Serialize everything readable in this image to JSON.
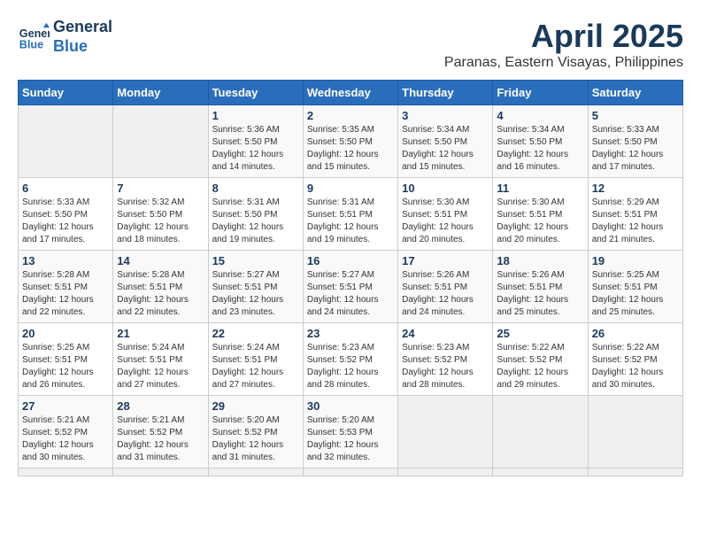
{
  "header": {
    "logo_line1": "General",
    "logo_line2": "Blue",
    "month": "April 2025",
    "location": "Paranas, Eastern Visayas, Philippines"
  },
  "weekdays": [
    "Sunday",
    "Monday",
    "Tuesday",
    "Wednesday",
    "Thursday",
    "Friday",
    "Saturday"
  ],
  "days": [
    {
      "day": "",
      "info": ""
    },
    {
      "day": "",
      "info": ""
    },
    {
      "day": "1",
      "sunrise": "5:36 AM",
      "sunset": "5:50 PM",
      "daylight": "12 hours and 14 minutes."
    },
    {
      "day": "2",
      "sunrise": "5:35 AM",
      "sunset": "5:50 PM",
      "daylight": "12 hours and 15 minutes."
    },
    {
      "day": "3",
      "sunrise": "5:34 AM",
      "sunset": "5:50 PM",
      "daylight": "12 hours and 15 minutes."
    },
    {
      "day": "4",
      "sunrise": "5:34 AM",
      "sunset": "5:50 PM",
      "daylight": "12 hours and 16 minutes."
    },
    {
      "day": "5",
      "sunrise": "5:33 AM",
      "sunset": "5:50 PM",
      "daylight": "12 hours and 17 minutes."
    },
    {
      "day": "6",
      "sunrise": "5:33 AM",
      "sunset": "5:50 PM",
      "daylight": "12 hours and 17 minutes."
    },
    {
      "day": "7",
      "sunrise": "5:32 AM",
      "sunset": "5:50 PM",
      "daylight": "12 hours and 18 minutes."
    },
    {
      "day": "8",
      "sunrise": "5:31 AM",
      "sunset": "5:50 PM",
      "daylight": "12 hours and 19 minutes."
    },
    {
      "day": "9",
      "sunrise": "5:31 AM",
      "sunset": "5:51 PM",
      "daylight": "12 hours and 19 minutes."
    },
    {
      "day": "10",
      "sunrise": "5:30 AM",
      "sunset": "5:51 PM",
      "daylight": "12 hours and 20 minutes."
    },
    {
      "day": "11",
      "sunrise": "5:30 AM",
      "sunset": "5:51 PM",
      "daylight": "12 hours and 20 minutes."
    },
    {
      "day": "12",
      "sunrise": "5:29 AM",
      "sunset": "5:51 PM",
      "daylight": "12 hours and 21 minutes."
    },
    {
      "day": "13",
      "sunrise": "5:28 AM",
      "sunset": "5:51 PM",
      "daylight": "12 hours and 22 minutes."
    },
    {
      "day": "14",
      "sunrise": "5:28 AM",
      "sunset": "5:51 PM",
      "daylight": "12 hours and 22 minutes."
    },
    {
      "day": "15",
      "sunrise": "5:27 AM",
      "sunset": "5:51 PM",
      "daylight": "12 hours and 23 minutes."
    },
    {
      "day": "16",
      "sunrise": "5:27 AM",
      "sunset": "5:51 PM",
      "daylight": "12 hours and 24 minutes."
    },
    {
      "day": "17",
      "sunrise": "5:26 AM",
      "sunset": "5:51 PM",
      "daylight": "12 hours and 24 minutes."
    },
    {
      "day": "18",
      "sunrise": "5:26 AM",
      "sunset": "5:51 PM",
      "daylight": "12 hours and 25 minutes."
    },
    {
      "day": "19",
      "sunrise": "5:25 AM",
      "sunset": "5:51 PM",
      "daylight": "12 hours and 25 minutes."
    },
    {
      "day": "20",
      "sunrise": "5:25 AM",
      "sunset": "5:51 PM",
      "daylight": "12 hours and 26 minutes."
    },
    {
      "day": "21",
      "sunrise": "5:24 AM",
      "sunset": "5:51 PM",
      "daylight": "12 hours and 27 minutes."
    },
    {
      "day": "22",
      "sunrise": "5:24 AM",
      "sunset": "5:51 PM",
      "daylight": "12 hours and 27 minutes."
    },
    {
      "day": "23",
      "sunrise": "5:23 AM",
      "sunset": "5:52 PM",
      "daylight": "12 hours and 28 minutes."
    },
    {
      "day": "24",
      "sunrise": "5:23 AM",
      "sunset": "5:52 PM",
      "daylight": "12 hours and 28 minutes."
    },
    {
      "day": "25",
      "sunrise": "5:22 AM",
      "sunset": "5:52 PM",
      "daylight": "12 hours and 29 minutes."
    },
    {
      "day": "26",
      "sunrise": "5:22 AM",
      "sunset": "5:52 PM",
      "daylight": "12 hours and 30 minutes."
    },
    {
      "day": "27",
      "sunrise": "5:21 AM",
      "sunset": "5:52 PM",
      "daylight": "12 hours and 30 minutes."
    },
    {
      "day": "28",
      "sunrise": "5:21 AM",
      "sunset": "5:52 PM",
      "daylight": "12 hours and 31 minutes."
    },
    {
      "day": "29",
      "sunrise": "5:20 AM",
      "sunset": "5:52 PM",
      "daylight": "12 hours and 31 minutes."
    },
    {
      "day": "30",
      "sunrise": "5:20 AM",
      "sunset": "5:53 PM",
      "daylight": "12 hours and 32 minutes."
    },
    {
      "day": "",
      "info": ""
    },
    {
      "day": "",
      "info": ""
    },
    {
      "day": "",
      "info": ""
    },
    {
      "day": "",
      "info": ""
    }
  ]
}
